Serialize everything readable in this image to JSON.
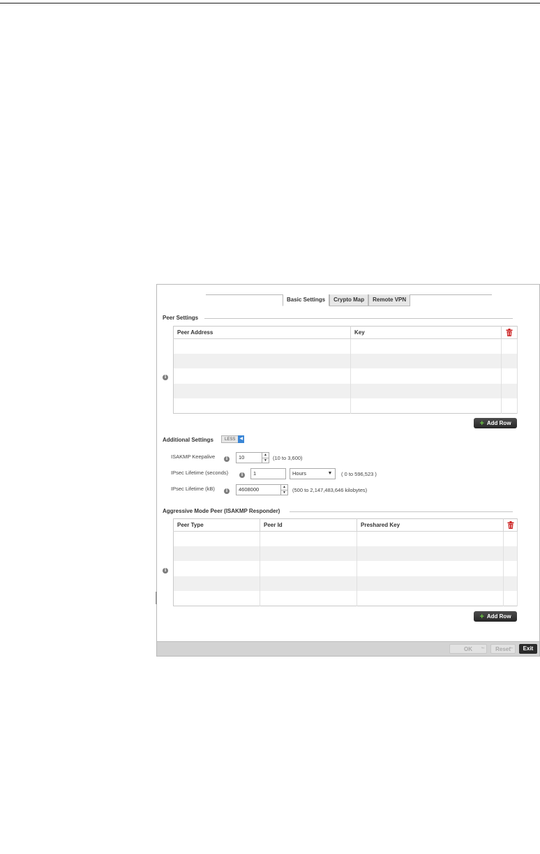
{
  "tabs": [
    "Basic Settings",
    "Crypto Map",
    "Remote VPN"
  ],
  "peer_settings": {
    "title": "Peer Settings",
    "columns": [
      "Peer Address",
      "Key"
    ],
    "rows": 5,
    "add_row": "Add Row"
  },
  "additional_settings": {
    "title": "Additional Settings",
    "toggle_label": "LESS",
    "isakmp_keepalive": {
      "label": "ISAKMP Keepalive",
      "value": "10",
      "range": "(10 to 3,600)"
    },
    "ipsec_lifetime_seconds": {
      "label": "IPsec Lifetime (seconds)",
      "value": "1",
      "unit": "Hours",
      "range": "( 0 to 596,523 )"
    },
    "ipsec_lifetime_kb": {
      "label": "IPsec Lifetime (kB)",
      "value": "4608000",
      "range": "(500 to 2,147,483,646 kilobytes)"
    }
  },
  "aggressive_mode": {
    "title": "Aggressive Mode Peer (ISAKMP Responder)",
    "columns": [
      "Peer Type",
      "Peer Id",
      "Preshared Key"
    ],
    "rows": 5,
    "add_row": "Add Row"
  },
  "footer": {
    "ok": "OK",
    "reset": "Reset",
    "exit": "Exit"
  },
  "colors": {
    "trash": "#cc2222",
    "accent": "#3a86d6",
    "add_plus": "#6cc644"
  }
}
